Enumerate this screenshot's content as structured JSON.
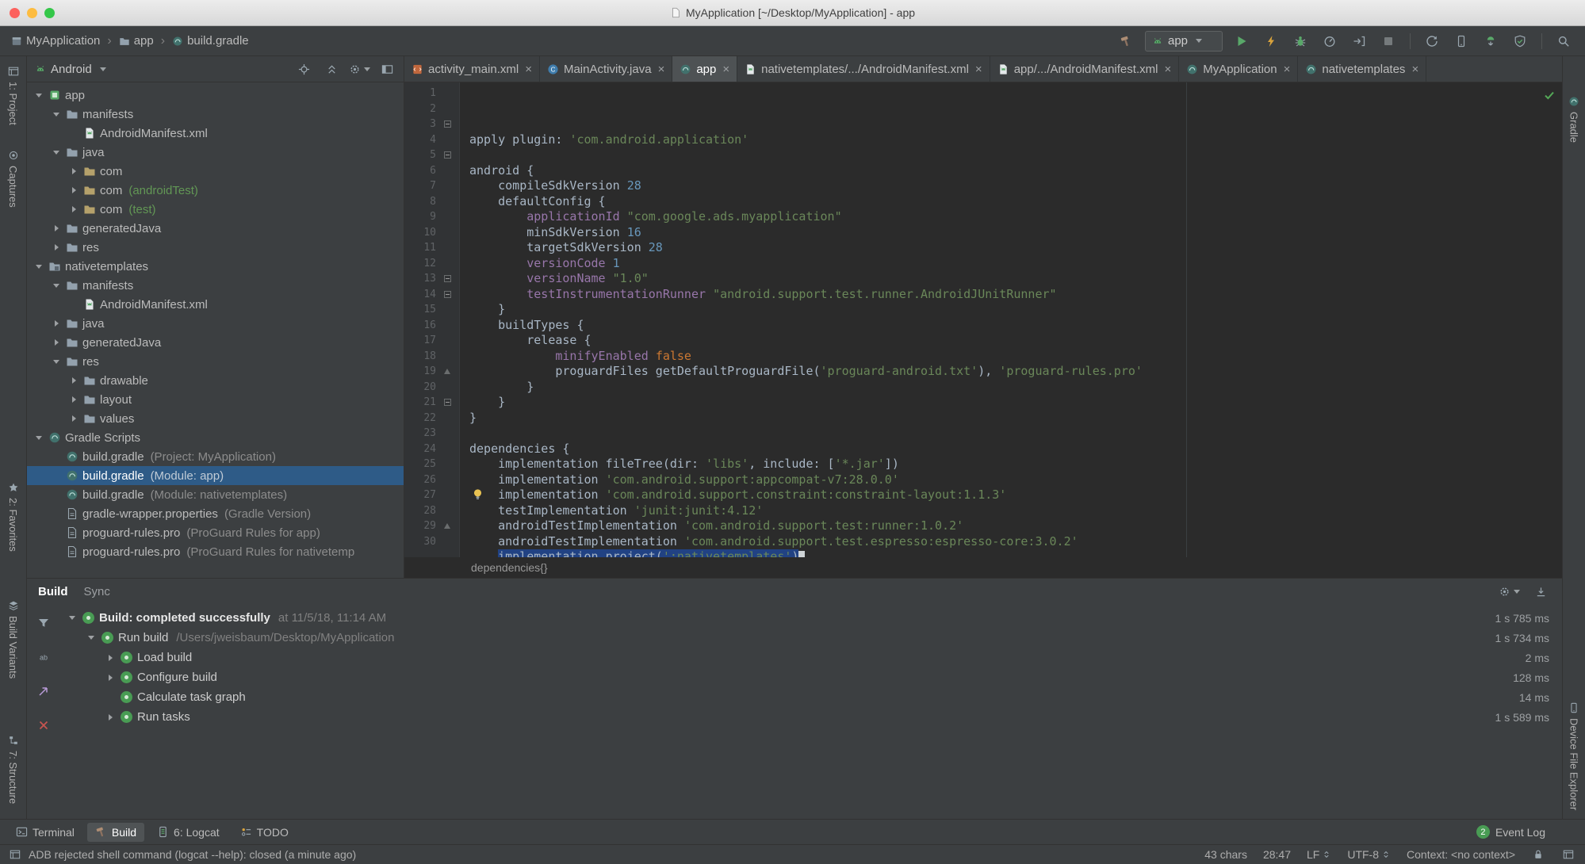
{
  "colors": {
    "panel": "#3c3f41",
    "editor": "#2b2b2b",
    "selection": "#214283",
    "tree_selection": "#2e5b87",
    "string": "#6a8759",
    "keyword": "#cc7832",
    "number": "#6897bb",
    "member": "#9876aa",
    "plain": "#a9b7c6",
    "accent_green": "#499C54",
    "error_red": "#c75450",
    "warning_yellow": "#d9a33c"
  },
  "titlebar": {
    "title": "MyApplication [~/Desktop/MyApplication] - app"
  },
  "toolbar": {
    "breadcrumb": [
      {
        "label": "MyApplication",
        "icon": "project"
      },
      {
        "label": "app",
        "icon": "folder"
      },
      {
        "label": "build.gradle",
        "icon": "gradle"
      }
    ],
    "run_config": "app",
    "actions": [
      {
        "icon": "run",
        "name": "run-button"
      },
      {
        "icon": "instant-run",
        "name": "apply-changes-button"
      },
      {
        "icon": "debug",
        "name": "debug-button"
      },
      {
        "icon": "profile",
        "name": "profile-button"
      },
      {
        "icon": "attach-debugger",
        "name": "attach-debugger-button"
      },
      {
        "icon": "stop",
        "name": "stop-button"
      },
      {
        "divider": true
      },
      {
        "icon": "gradle-sync",
        "name": "gradle-sync-button"
      },
      {
        "icon": "avd-manager",
        "name": "avd-manager-button"
      },
      {
        "icon": "sdk-manager",
        "name": "sdk-manager-button"
      },
      {
        "icon": "shield-check",
        "name": "lint-check-button"
      },
      {
        "divider": true
      },
      {
        "icon": "search",
        "name": "search-everywhere-button"
      }
    ]
  },
  "stripes": {
    "left": [
      {
        "label": "1: Project",
        "icon": "frame",
        "name": "toolwindow-project-button"
      },
      {
        "label": "Captures",
        "icon": "captures",
        "name": "toolwindow-captures-button"
      },
      {
        "label": "2: Favorites",
        "icon": "star",
        "name": "toolwindow-favorites-button"
      },
      {
        "label": "Build Variants",
        "icon": "variants",
        "name": "toolwindow-build-variants-button"
      },
      {
        "label": "7: Structure",
        "icon": "structure",
        "name": "toolwindow-structure-button"
      }
    ],
    "right": [
      {
        "label": "Gradle",
        "icon": "gradle",
        "name": "toolwindow-gradle-button"
      },
      {
        "label": "Device File Explorer",
        "icon": "avd-manager",
        "name": "toolwindow-device-file-explorer-button"
      }
    ]
  },
  "project": {
    "view": "Android",
    "header_icons": [
      {
        "icon": "locate",
        "name": "locate-button"
      },
      {
        "icon": "collapse-all",
        "name": "collapse-all-button"
      },
      {
        "icon": "gear",
        "name": "settings-button",
        "dd": true
      },
      {
        "icon": "hide-panel",
        "name": "hide-panel-button"
      }
    ],
    "tree": [
      {
        "l": 0,
        "c": "d",
        "i": "app-module",
        "t": "app"
      },
      {
        "l": 1,
        "c": "d",
        "i": "folder",
        "t": "manifests"
      },
      {
        "l": 2,
        "c": "",
        "i": "manifest",
        "t": "AndroidManifest.xml"
      },
      {
        "l": 1,
        "c": "d",
        "i": "folder",
        "t": "java"
      },
      {
        "l": 2,
        "c": "r",
        "i": "package",
        "t": "com"
      },
      {
        "l": 2,
        "c": "r",
        "i": "package",
        "t": "com",
        "s": "(androidTest)",
        "g": true
      },
      {
        "l": 2,
        "c": "r",
        "i": "package",
        "t": "com",
        "s": "(test)",
        "g": true
      },
      {
        "l": 1,
        "c": "r",
        "i": "folder",
        "t": "generatedJava"
      },
      {
        "l": 1,
        "c": "r",
        "i": "folder",
        "t": "res"
      },
      {
        "l": 0,
        "c": "d",
        "i": "module",
        "t": "nativetemplates"
      },
      {
        "l": 1,
        "c": "d",
        "i": "folder",
        "t": "manifests"
      },
      {
        "l": 2,
        "c": "",
        "i": "manifest",
        "t": "AndroidManifest.xml"
      },
      {
        "l": 1,
        "c": "r",
        "i": "folder",
        "t": "java"
      },
      {
        "l": 1,
        "c": "r",
        "i": "folder",
        "t": "generatedJava"
      },
      {
        "l": 1,
        "c": "d",
        "i": "folder",
        "t": "res"
      },
      {
        "l": 2,
        "c": "r",
        "i": "folder",
        "t": "drawable"
      },
      {
        "l": 2,
        "c": "r",
        "i": "folder",
        "t": "layout"
      },
      {
        "l": 2,
        "c": "r",
        "i": "folder",
        "t": "values"
      },
      {
        "l": 0,
        "c": "d",
        "i": "gradle",
        "t": "Gradle Scripts"
      },
      {
        "l": 1,
        "c": "",
        "i": "gradle",
        "t": "build.gradle",
        "s": "(Project: MyApplication)"
      },
      {
        "l": 1,
        "c": "",
        "i": "gradle",
        "t": "build.gradle",
        "s": "(Module: app)",
        "sel": true
      },
      {
        "l": 1,
        "c": "",
        "i": "gradle",
        "t": "build.gradle",
        "s": "(Module: nativetemplates)"
      },
      {
        "l": 1,
        "c": "",
        "i": "file",
        "t": "gradle-wrapper.properties",
        "s": "(Gradle Version)"
      },
      {
        "l": 1,
        "c": "",
        "i": "file",
        "t": "proguard-rules.pro",
        "s": "(ProGuard Rules for app)"
      },
      {
        "l": 1,
        "c": "",
        "i": "file",
        "t": "proguard-rules.pro",
        "s": "(ProGuard Rules for nativetemp"
      }
    ]
  },
  "editor": {
    "tabs": [
      {
        "label": "activity_main.xml",
        "icon": "xml-file",
        "name": "tab-activity-main"
      },
      {
        "label": "MainActivity.java",
        "icon": "class",
        "name": "tab-mainactivity"
      },
      {
        "label": "app",
        "icon": "gradle",
        "active": true,
        "name": "tab-app-gradle"
      },
      {
        "label": "nativetemplates/.../AndroidManifest.xml",
        "icon": "manifest",
        "name": "tab-nativetemplates-manifest"
      },
      {
        "label": "app/.../AndroidManifest.xml",
        "icon": "manifest",
        "name": "tab-app-manifest"
      },
      {
        "label": "MyApplication",
        "icon": "gradle",
        "name": "tab-myapplication-gradle"
      },
      {
        "label": "nativetemplates",
        "icon": "gradle",
        "name": "tab-nativetemplates-gradle"
      }
    ],
    "breadcrumb": "dependencies{}",
    "lines": [
      {
        "n": "1",
        "t": [
          [
            "p",
            "apply plugin: "
          ],
          [
            "s",
            "'com.android.application'"
          ]
        ]
      },
      {
        "n": "2",
        "t": []
      },
      {
        "n": "3",
        "f": "m",
        "t": [
          [
            "p",
            "android {"
          ]
        ]
      },
      {
        "n": "4",
        "t": [
          [
            "p",
            "    compileSdkVersion "
          ],
          [
            "n",
            "28"
          ]
        ]
      },
      {
        "n": "5",
        "f": "m",
        "t": [
          [
            "p",
            "    defaultConfig {"
          ]
        ]
      },
      {
        "n": "6",
        "t": [
          [
            "p",
            "        "
          ],
          [
            "f",
            "applicationId"
          ],
          [
            "p",
            " "
          ],
          [
            "s",
            "\"com.google.ads.myapplication\""
          ]
        ]
      },
      {
        "n": "7",
        "t": [
          [
            "p",
            "        minSdkVersion "
          ],
          [
            "n",
            "16"
          ]
        ]
      },
      {
        "n": "8",
        "t": [
          [
            "p",
            "        targetSdkVersion "
          ],
          [
            "n",
            "28"
          ]
        ]
      },
      {
        "n": "9",
        "t": [
          [
            "p",
            "        "
          ],
          [
            "f",
            "versionCode"
          ],
          [
            "p",
            " "
          ],
          [
            "n",
            "1"
          ]
        ]
      },
      {
        "n": "10",
        "t": [
          [
            "p",
            "        "
          ],
          [
            "f",
            "versionName"
          ],
          [
            "p",
            " "
          ],
          [
            "s",
            "\"1.0\""
          ]
        ]
      },
      {
        "n": "11",
        "t": [
          [
            "p",
            "        "
          ],
          [
            "f",
            "testInstrumentationRunner"
          ],
          [
            "p",
            " "
          ],
          [
            "s",
            "\"android.support.test.runner.AndroidJUnitRunner\""
          ]
        ]
      },
      {
        "n": "12",
        "t": [
          [
            "p",
            "    }"
          ]
        ]
      },
      {
        "n": "13",
        "f": "m",
        "t": [
          [
            "p",
            "    buildTypes {"
          ]
        ]
      },
      {
        "n": "14",
        "f": "m",
        "t": [
          [
            "p",
            "        release {"
          ]
        ]
      },
      {
        "n": "15",
        "t": [
          [
            "p",
            "            "
          ],
          [
            "f",
            "minifyEnabled"
          ],
          [
            "p",
            " "
          ],
          [
            "k",
            "false"
          ]
        ]
      },
      {
        "n": "16",
        "t": [
          [
            "p",
            "            proguardFiles getDefaultProguardFile("
          ],
          [
            "s",
            "'proguard-android.txt'"
          ],
          [
            "p",
            "), "
          ],
          [
            "s",
            "'proguard-rules.pro'"
          ]
        ]
      },
      {
        "n": "17",
        "t": [
          [
            "p",
            "        }"
          ]
        ]
      },
      {
        "n": "18",
        "t": [
          [
            "p",
            "    }"
          ]
        ]
      },
      {
        "n": "19",
        "f": "u",
        "t": [
          [
            "p",
            "}"
          ]
        ]
      },
      {
        "n": "20",
        "t": []
      },
      {
        "n": "21",
        "f": "m",
        "t": [
          [
            "p",
            "dependencies {"
          ]
        ]
      },
      {
        "n": "22",
        "t": [
          [
            "p",
            "    implementation fileTree(dir: "
          ],
          [
            "s",
            "'libs'"
          ],
          [
            "p",
            ", include: ["
          ],
          [
            "s",
            "'*.jar'"
          ],
          [
            "p",
            "])"
          ]
        ]
      },
      {
        "n": "23",
        "t": [
          [
            "p",
            "    implementation "
          ],
          [
            "s",
            "'com.android.support:appcompat-v7:28.0.0'"
          ]
        ]
      },
      {
        "n": "24",
        "t": [
          [
            "p",
            "    implementation "
          ],
          [
            "s",
            "'com.android.support.constraint:constraint-layout:1.1.3'"
          ]
        ]
      },
      {
        "n": "25",
        "t": [
          [
            "p",
            "    testImplementation "
          ],
          [
            "s",
            "'junit:junit:4.12'"
          ]
        ]
      },
      {
        "n": "26",
        "t": [
          [
            "p",
            "    androidTestImplementation "
          ],
          [
            "s",
            "'com.android.support.test:runner:1.0.2'"
          ]
        ]
      },
      {
        "n": "27",
        "t": [
          [
            "p",
            "    androidTestImplementation "
          ],
          [
            "s",
            "'com.android.support.test.espresso:espresso-core:3.0.2'"
          ]
        ]
      },
      {
        "n": "28",
        "t": [
          [
            "p",
            "    "
          ],
          [
            "p",
            "implementation project(",
            "sel"
          ],
          [
            "s",
            "':nativetemplates'",
            "sel"
          ],
          [
            "p",
            ")",
            "sel"
          ],
          [
            "c",
            ""
          ]
        ]
      },
      {
        "n": "29",
        "f": "u",
        "t": [
          [
            "p",
            "}"
          ]
        ]
      },
      {
        "n": "30",
        "t": []
      }
    ]
  },
  "build_panel": {
    "tabs": [
      {
        "label": "Build",
        "active": true
      },
      {
        "label": "Sync"
      }
    ],
    "header_icons": [
      {
        "icon": "gear",
        "name": "build-settings-button",
        "dd": true
      },
      {
        "icon": "collapse-panel",
        "name": "minimize-panel-button"
      }
    ],
    "toolbar": [
      {
        "icon": "funnel",
        "name": "filter-button"
      },
      {
        "icon": "ab",
        "name": "text-filter-button"
      },
      {
        "icon": "step-arrow",
        "name": "jump-to-source-button"
      },
      {
        "icon": "close-red",
        "name": "close-button"
      }
    ],
    "rows": [
      {
        "lvl": 0,
        "ch": "d",
        "label": "Build: completed successfully",
        "bold": true,
        "detail": "at 11/5/18, 11:14 AM",
        "time": "1 s 785 ms"
      },
      {
        "lvl": 1,
        "ch": "d",
        "label": "Run build",
        "detail": "/Users/jweisbaum/Desktop/MyApplication",
        "time": "1 s 734 ms"
      },
      {
        "lvl": 2,
        "ch": "r",
        "label": "Load build",
        "time": "2 ms"
      },
      {
        "lvl": 2,
        "ch": "r",
        "label": "Configure build",
        "time": "128 ms"
      },
      {
        "lvl": 2,
        "ch": "",
        "label": "Calculate task graph",
        "time": "14 ms"
      },
      {
        "lvl": 2,
        "ch": "r",
        "label": "Run tasks",
        "time": "1 s 589 ms"
      }
    ]
  },
  "bottom_bar": {
    "items": [
      {
        "label": "Terminal",
        "icon": "terminal",
        "name": "toolwindow-terminal-button"
      },
      {
        "label": "Build",
        "icon": "hammer",
        "active": true,
        "name": "toolwindow-build-button"
      },
      {
        "label": "6: Logcat",
        "icon": "logcat",
        "name": "toolwindow-logcat-button"
      },
      {
        "label": "TODO",
        "icon": "todo",
        "name": "toolwindow-todo-button"
      }
    ],
    "event_log": {
      "badge": "2",
      "label": "Event Log"
    }
  },
  "status_bar": {
    "message": "ADB rejected shell command (logcat --help): closed (a minute ago)",
    "items": [
      {
        "text": "43 chars"
      },
      {
        "text": "28:47",
        "name": "caret-position"
      },
      {
        "text": "LF",
        "updown": true,
        "name": "line-ending-select"
      },
      {
        "text": "UTF-8",
        "updown": true,
        "name": "encoding-select"
      },
      {
        "text": "Context: <no context>",
        "name": "context-indicator"
      }
    ],
    "icons": [
      {
        "icon": "lock",
        "name": "readonly-lock-button"
      },
      {
        "icon": "frame",
        "name": "toolwindow-toggle-button"
      }
    ]
  }
}
